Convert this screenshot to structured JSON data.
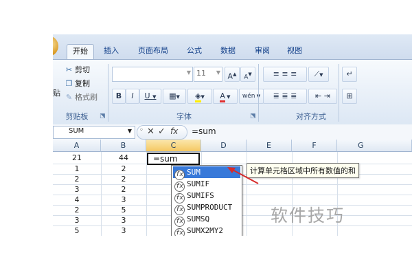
{
  "ribbon": {
    "tabs": [
      "开始",
      "插入",
      "页面布局",
      "公式",
      "数据",
      "审阅",
      "视图"
    ],
    "clipboard": {
      "paste_label": "贴",
      "cut_label": "剪切",
      "copy_label": "复制",
      "format_painter_label": "格式刷",
      "group_label": "剪贴板"
    },
    "font": {
      "font_size": "11",
      "grow_label": "A",
      "shrink_label": "A",
      "bold_label": "B",
      "italic_label": "I",
      "underline_label": "U",
      "color_label": "A",
      "phonetic_label": "wén",
      "group_label": "字体"
    },
    "alignment": {
      "group_label": "对齐方式"
    }
  },
  "formula_bar": {
    "name_box": "SUM",
    "cancel_symbol": "✕",
    "enter_symbol": "✓",
    "fx_label": "fx",
    "formula": "=sum"
  },
  "sheet": {
    "columns": [
      "A",
      "B",
      "C",
      "D",
      "E",
      "F",
      "G"
    ],
    "rows": [
      [
        "21",
        "44"
      ],
      [
        "1",
        "2"
      ],
      [
        "2",
        "2"
      ],
      [
        "3",
        "2"
      ],
      [
        "4",
        "3"
      ],
      [
        "2",
        "5"
      ],
      [
        "3",
        "3"
      ],
      [
        "5",
        "3"
      ]
    ],
    "active_cell_text": "=sum"
  },
  "autocomplete": {
    "items": [
      "SUM",
      "SUMIF",
      "SUMIFS",
      "SUMPRODUCT",
      "SUMSQ",
      "SUMX2MY2"
    ],
    "selected": "SUM",
    "tooltip": "计算单元格区域中所有数值的和"
  },
  "watermark": "软件技巧",
  "colors": {
    "selection": "#3879d9",
    "annotation_arrow": "#d62b2b",
    "active_header": "#f5c862"
  }
}
